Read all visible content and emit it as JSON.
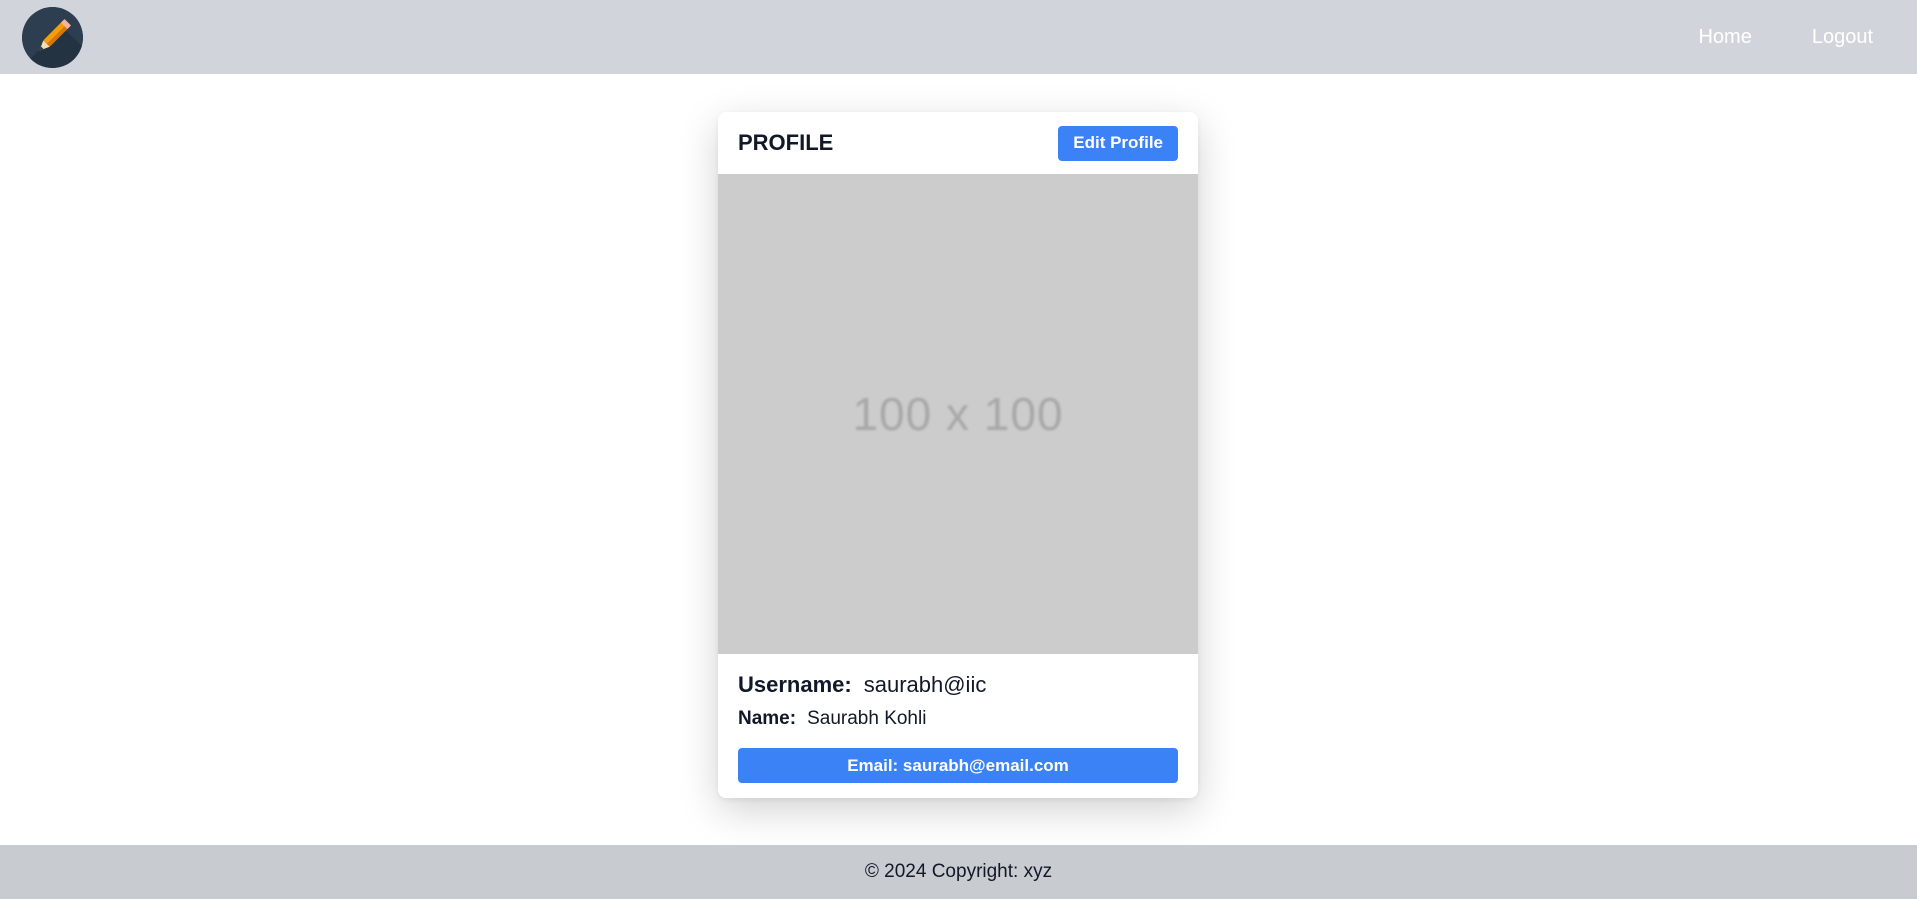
{
  "navbar": {
    "logo_icon": "pencil-icon",
    "links": [
      {
        "label": "Home"
      },
      {
        "label": "Logout"
      }
    ]
  },
  "profile": {
    "title": "PROFILE",
    "edit_label": "Edit Profile",
    "image_placeholder": "100 x 100",
    "username_label": "Username:",
    "username_value": "saurabh@iic",
    "name_label": "Name:",
    "name_value": "Saurabh Kohli",
    "email_label": "Email: saurabh@email.com"
  },
  "footer": {
    "text": "© 2024 Copyright: xyz"
  },
  "colors": {
    "navbar_bg": "#d1d5db",
    "accent": "#3b82f6",
    "footer_bg": "#c8cbd0",
    "placeholder_bg": "#cccccc"
  }
}
